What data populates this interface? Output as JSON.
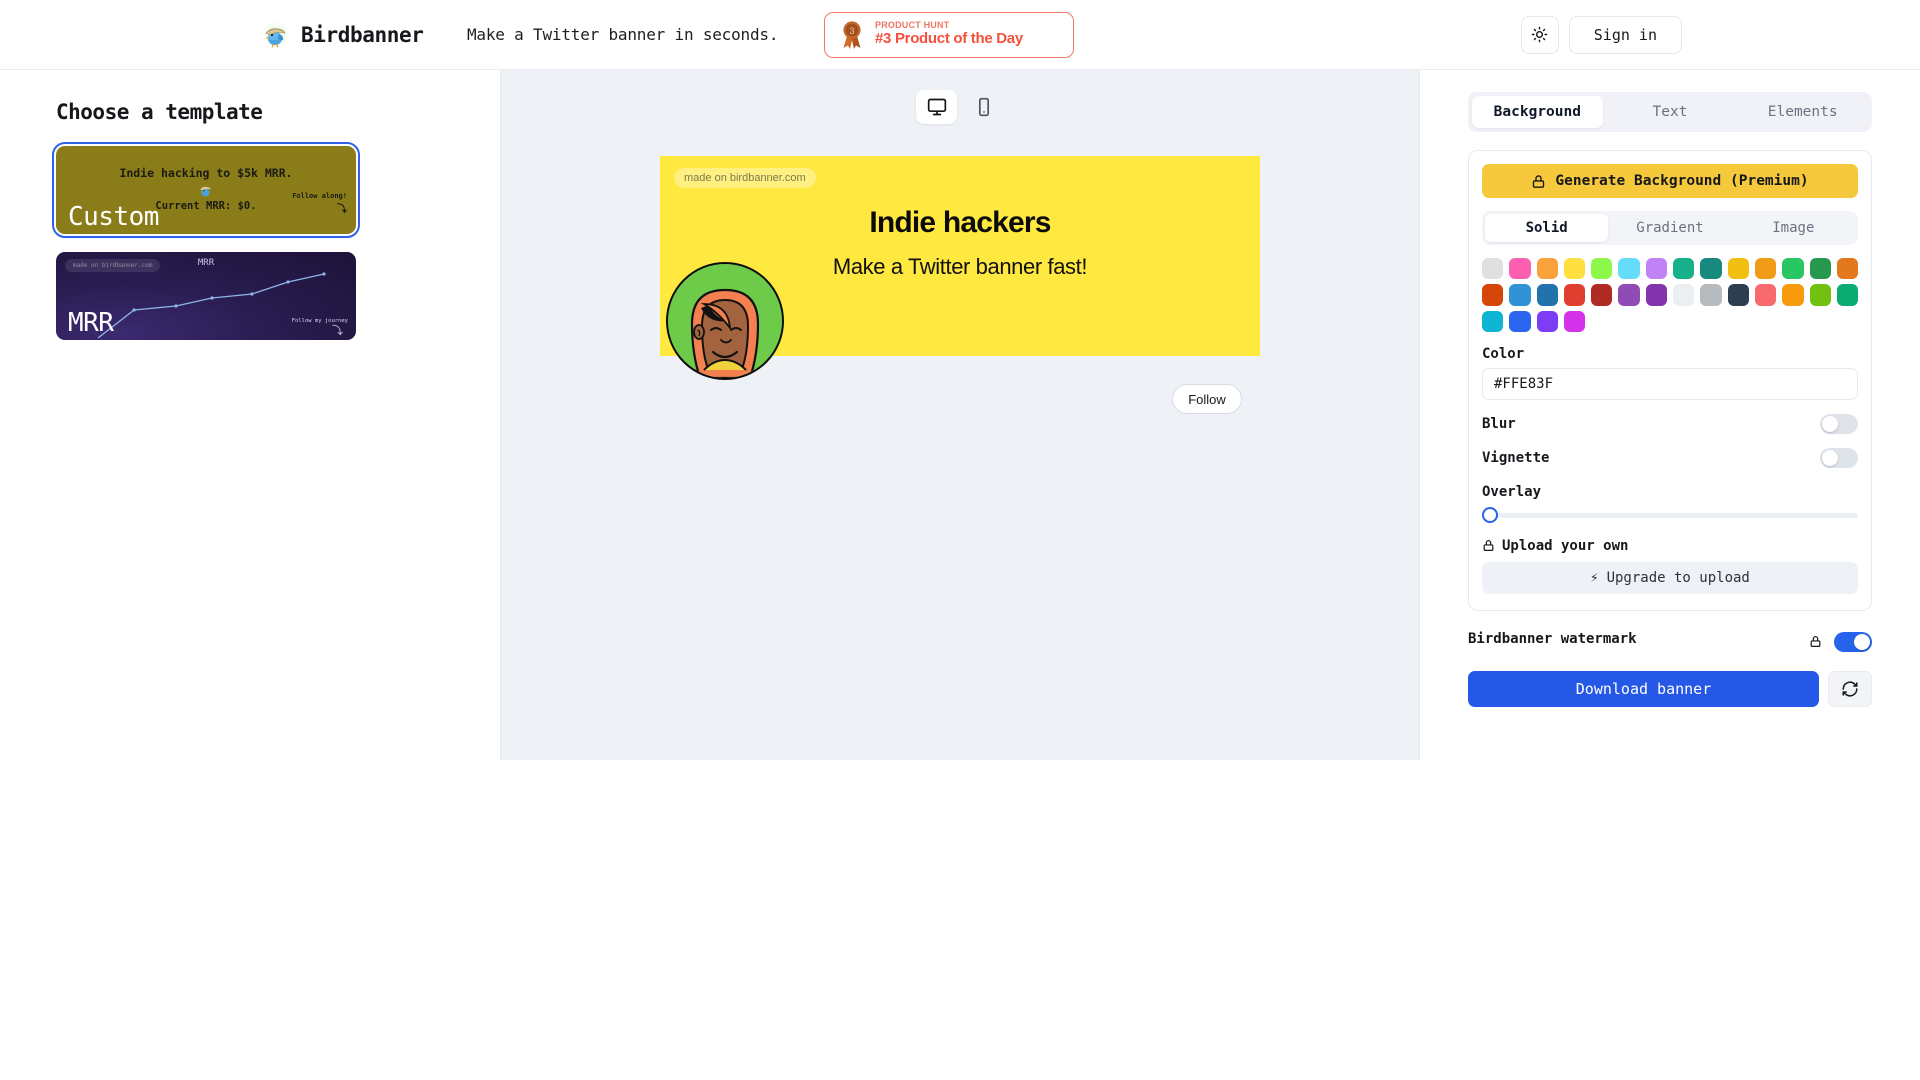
{
  "header": {
    "brand_name": "Birdbanner",
    "logo_icon": "bird-banner-logo",
    "tagline": "Make a Twitter banner in seconds.",
    "product_hunt": {
      "kicker": "PRODUCT HUNT",
      "title": "#3 Product of the Day",
      "medal_icon": "medal-icon",
      "rank": "3",
      "border_color": "#f07a67",
      "title_color": "#f4503c"
    },
    "theme_toggle_icon": "sun-icon",
    "sign_in_label": "Sign in"
  },
  "sidebar": {
    "title": "Choose a template",
    "templates": [
      {
        "label": "Custom",
        "selected": true,
        "bg_color": "#8a7d19",
        "headline": "Indie hacking to $5k MRR.",
        "subline": "Current MRR: $0.",
        "corner_text": "Follow along!",
        "corner_arrow": "⤵",
        "avatar_icon": "bird-banner-logo"
      },
      {
        "label": "MRR",
        "selected": false,
        "bg_color": "#2a1d52",
        "watermark": "made on birdbanner.com",
        "chart_title": "MRR",
        "corner_text": "Follow my journey",
        "corner_arrow": "⤵"
      }
    ]
  },
  "canvas": {
    "device_options": [
      {
        "name": "desktop",
        "icon": "monitor-icon",
        "active": true
      },
      {
        "name": "mobile",
        "icon": "phone-icon",
        "active": false
      }
    ],
    "banner": {
      "background_color": "#FFE83F",
      "watermark": "made on birdbanner.com",
      "headline": "Indie hackers",
      "subheadline": "Make a Twitter banner fast!",
      "avatar_icon": "avatar-illustration",
      "avatar_ring_color": "#6dcb49"
    },
    "follow_label": "Follow"
  },
  "panel": {
    "tabs": [
      {
        "label": "Background",
        "active": true
      },
      {
        "label": "Text",
        "active": false
      },
      {
        "label": "Elements",
        "active": false
      }
    ],
    "generate_button": {
      "label": "Generate Background (Premium)",
      "icon": "lock-icon",
      "color": "#F6C83C"
    },
    "fill_modes": [
      {
        "label": "Solid",
        "active": true
      },
      {
        "label": "Gradient",
        "active": false
      },
      {
        "label": "Image",
        "active": false
      }
    ],
    "swatches": [
      "#e0e0e0",
      "#fd5fb0",
      "#f9a13a",
      "#ffe040",
      "#8bf84a",
      "#64dcfa",
      "#c083f7",
      "#16b08a",
      "#17897f",
      "#f1bf12",
      "#f19c18",
      "#28c763",
      "#27994f",
      "#e2791f",
      "#d54708",
      "#3192d6",
      "#2273ab",
      "#e03f30",
      "#af2b23",
      "#8e4cb4",
      "#8134ad",
      "#eceff1",
      "#b6bbc0",
      "#2e3e51",
      "#f96a6e",
      "#f79b0d",
      "#72c010",
      "#0cab74",
      "#0eb4d1",
      "#2a66f0",
      "#7d3cf5",
      "#d431ea"
    ],
    "color_field": {
      "label": "Color",
      "value": "#FFE83F"
    },
    "blur": {
      "label": "Blur",
      "on": false
    },
    "vignette": {
      "label": "Vignette",
      "on": false
    },
    "overlay": {
      "label": "Overlay",
      "value": 0
    },
    "upload": {
      "label": "Upload your own",
      "lock_icon": "lock-icon",
      "upgrade_label": "Upgrade to upload",
      "upgrade_icon": "bolt-icon"
    },
    "watermark_row": {
      "label": "Birdbanner watermark",
      "lock_icon": "lock-icon",
      "on": true,
      "on_color": "#2563EB"
    },
    "download_button": {
      "label": "Download banner",
      "color": "#2558E6"
    },
    "refresh_button": {
      "icon": "refresh-icon"
    }
  }
}
